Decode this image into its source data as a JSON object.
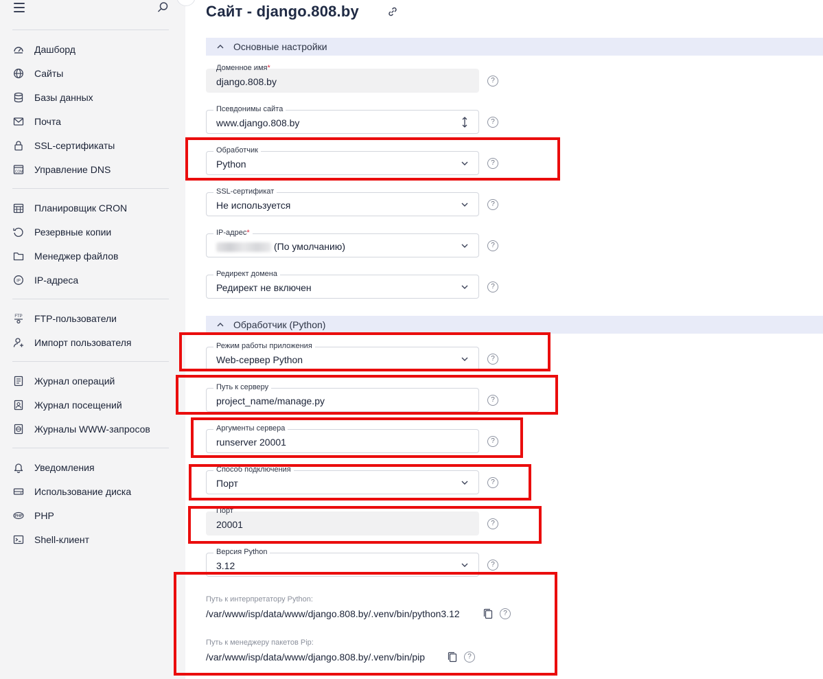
{
  "sidebar": {
    "items": [
      {
        "label": "Дашборд",
        "icon": "dashboard-icon"
      },
      {
        "label": "Сайты",
        "icon": "globe-icon"
      },
      {
        "label": "Базы данных",
        "icon": "database-icon"
      },
      {
        "label": "Почта",
        "icon": "mail-icon"
      },
      {
        "label": "SSL-сертификаты",
        "icon": "certificate-icon"
      },
      {
        "label": "Управление DNS",
        "icon": "dns-icon"
      },
      {
        "label": "Планировщик CRON",
        "icon": "calendar-icon"
      },
      {
        "label": "Резервные копии",
        "icon": "backup-icon"
      },
      {
        "label": "Менеджер файлов",
        "icon": "folder-icon"
      },
      {
        "label": "IP-адреса",
        "icon": "ip-icon"
      },
      {
        "label": "FTP-пользователи",
        "icon": "ftp-icon"
      },
      {
        "label": "Импорт пользователя",
        "icon": "user-import-icon"
      },
      {
        "label": "Журнал операций",
        "icon": "operations-log-icon"
      },
      {
        "label": "Журнал посещений",
        "icon": "visits-log-icon"
      },
      {
        "label": "Журналы WWW-запросов",
        "icon": "www-log-icon"
      },
      {
        "label": "Уведомления",
        "icon": "bell-icon"
      },
      {
        "label": "Использование диска",
        "icon": "disk-usage-icon"
      },
      {
        "label": "PHP",
        "icon": "php-icon"
      },
      {
        "label": "Shell-клиент",
        "icon": "terminal-icon"
      }
    ]
  },
  "page": {
    "title": "Сайт - django.808.by"
  },
  "sections": {
    "basic": "Основные настройки",
    "handler": "Обработчик (Python)"
  },
  "fields": {
    "domain": {
      "label": "Доменное имя",
      "required": "*",
      "value": "django.808.by"
    },
    "aliases": {
      "label": "Псевдонимы сайта",
      "value": "www.django.808.by"
    },
    "handler": {
      "label": "Обработчик",
      "value": "Python"
    },
    "ssl": {
      "label": "SSL-сертификат",
      "value": "Не используется"
    },
    "ip": {
      "label": "IP-адрес",
      "required": "*",
      "value": "(По умолчанию)"
    },
    "redirect": {
      "label": "Редирект домена",
      "value": "Редирект не включен"
    },
    "app_mode": {
      "label": "Режим работы приложения",
      "value": "Web-сервер Python"
    },
    "server_path": {
      "label": "Путь к серверу",
      "value": "project_name/manage.py"
    },
    "server_args": {
      "label": "Аргументы сервера",
      "value": "runserver 20001"
    },
    "connection": {
      "label": "Способ подключения",
      "value": "Порт"
    },
    "port": {
      "label": "Порт",
      "value": "20001"
    },
    "python_version": {
      "label": "Версия Python",
      "value": "3.12"
    }
  },
  "paths": {
    "interpreter": {
      "label": "Путь к интерпретатору Python:",
      "value": "/var/www/isp/data/www/django.808.by/.venv/bin/python3.12"
    },
    "pip": {
      "label": "Путь к менеджеру пакетов Pip:",
      "value": "/var/www/isp/data/www/django.808.by/.venv/bin/pip"
    }
  },
  "help_glyph": "?",
  "colors": {
    "highlight": "#ea0d0d",
    "section_bg": "#e8ebf8",
    "sidebar_bg": "#f4f4f5",
    "required": "#d8263c"
  }
}
